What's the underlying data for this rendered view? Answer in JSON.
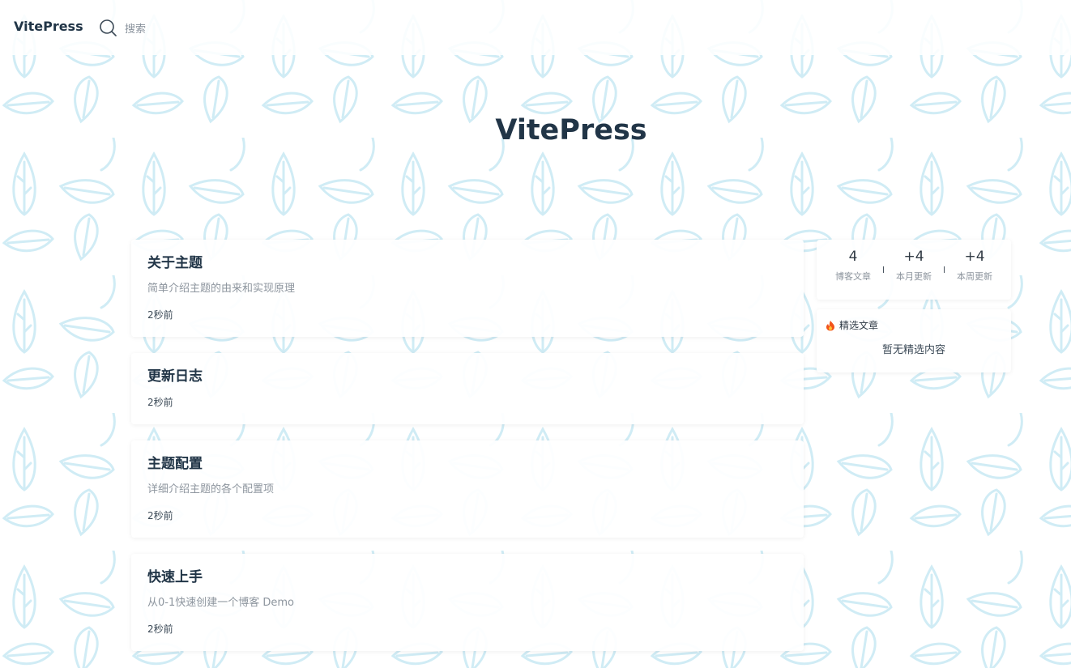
{
  "nav": {
    "site_title": "VitePress",
    "search_placeholder": "搜索"
  },
  "hero": {
    "title": "VitePress"
  },
  "posts": [
    {
      "title": "关于主题",
      "description": "简单介绍主题的由来和实现原理",
      "date": "2秒前"
    },
    {
      "title": "更新日志",
      "description": "",
      "date": "2秒前"
    },
    {
      "title": "主题配置",
      "description": "详细介绍主题的各个配置项",
      "date": "2秒前"
    },
    {
      "title": "快速上手",
      "description": "从0-1快速创建一个博客 Demo",
      "date": "2秒前"
    }
  ],
  "stats": [
    {
      "value": "4",
      "label": "博客文章"
    },
    {
      "value": "+4",
      "label": "本月更新"
    },
    {
      "value": "+4",
      "label": "本周更新"
    }
  ],
  "featured": {
    "icon": "fire-icon",
    "title": "精选文章",
    "empty_text": "暂无精选内容"
  },
  "colors": {
    "text": "#213547",
    "muted": "#8d959e",
    "pattern": "#9fd6ea",
    "fire": "#f2541b"
  }
}
